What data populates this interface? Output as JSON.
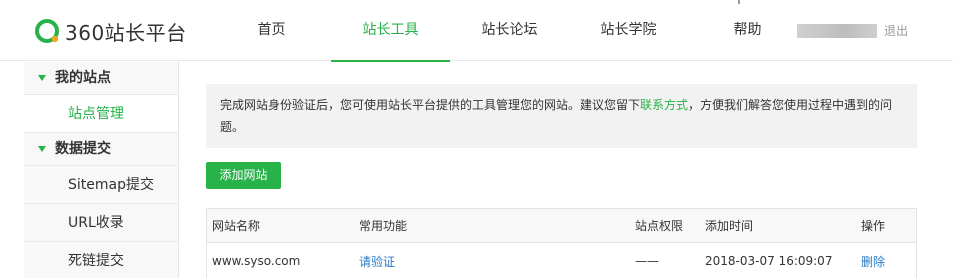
{
  "header": {
    "logo_text": "360站长平台",
    "nav": [
      {
        "label": "首页",
        "active": false
      },
      {
        "label": "站长工具",
        "active": true
      },
      {
        "label": "站长论坛",
        "active": false
      },
      {
        "label": "站长学院",
        "active": false
      },
      {
        "label": "帮助",
        "active": false
      }
    ],
    "logout": "退出"
  },
  "sidebar": {
    "groups": [
      {
        "label": "我的站点",
        "items": [
          {
            "label": "站点管理",
            "active": true
          }
        ]
      },
      {
        "label": "数据提交",
        "items": [
          {
            "label": "Sitemap提交",
            "active": false
          },
          {
            "label": "URL收录",
            "active": false
          },
          {
            "label": "死链提交",
            "active": false
          }
        ]
      }
    ]
  },
  "notice": {
    "text_before": "完成网站身份验证后，您可使用站长平台提供的工具管理您的网站。建议您留下",
    "link": "联系方式",
    "text_after": "，方便我们解答您使用过程中遇到的问题。"
  },
  "add_button": "添加网站",
  "table": {
    "headers": [
      "网站名称",
      "常用功能",
      "站点权限",
      "添加时间",
      "操作"
    ],
    "rows": [
      {
        "site": "www.syso.com",
        "function": "请验证",
        "permission": "——",
        "time": "2018-03-07 16:09:07",
        "action": "删除"
      }
    ]
  },
  "colors": {
    "accent": "#27b24a",
    "link": "#2a7ac9"
  }
}
